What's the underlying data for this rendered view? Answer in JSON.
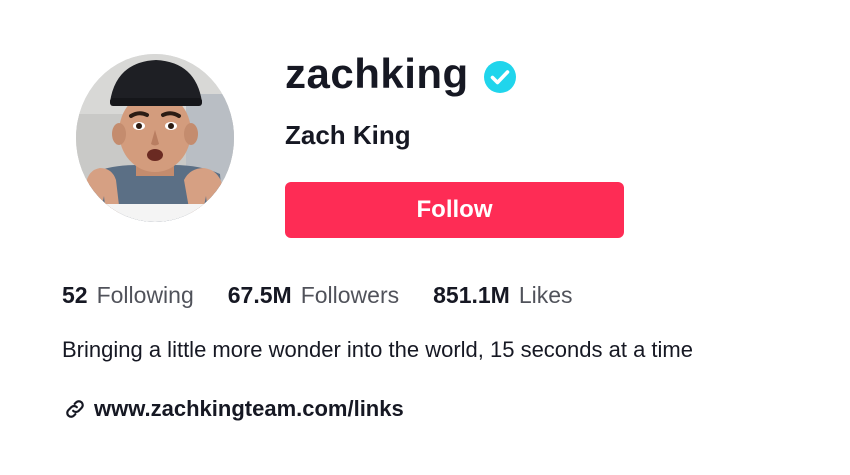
{
  "profile": {
    "username": "zachking",
    "display_name": "Zach King",
    "verified": true,
    "avatar_icon": "avatar-photo",
    "verified_icon": "verified-badge-icon"
  },
  "actions": {
    "follow_label": "Follow"
  },
  "stats": [
    {
      "value": "52",
      "label": "Following"
    },
    {
      "value": "67.5M",
      "label": "Followers"
    },
    {
      "value": "851.1M",
      "label": "Likes"
    }
  ],
  "bio": "Bringing a little more wonder into the world, 15 seconds at a time",
  "link": {
    "icon": "link-icon",
    "text": "www.zachkingteam.com/links"
  },
  "colors": {
    "follow_button": "#fe2c55",
    "verified_badge": "#20d5ec",
    "text_primary": "#161823"
  }
}
